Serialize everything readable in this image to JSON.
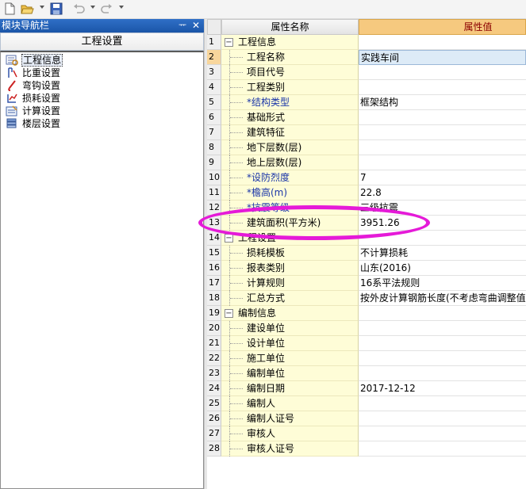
{
  "toolbar": {
    "buttons": [
      {
        "name": "new-file-icon"
      },
      {
        "name": "open-folder-icon"
      },
      {
        "name": "save-icon"
      },
      {
        "name": "undo-icon"
      },
      {
        "name": "redo-icon"
      }
    ]
  },
  "nav": {
    "title": "模块导航栏",
    "pin_glyph": "ᅲ",
    "close_glyph": "✕",
    "header": "工程设置",
    "items": [
      {
        "label": "工程信息",
        "icon": "project-info-icon",
        "selected": true
      },
      {
        "label": "比重设置",
        "icon": "density-icon",
        "selected": false
      },
      {
        "label": "弯钩设置",
        "icon": "hook-icon",
        "selected": false
      },
      {
        "label": "损耗设置",
        "icon": "loss-icon",
        "selected": false
      },
      {
        "label": "计算设置",
        "icon": "calc-settings-icon",
        "selected": false
      },
      {
        "label": "楼层设置",
        "icon": "floor-settings-icon",
        "selected": false
      }
    ]
  },
  "grid": {
    "col_name": "属性名称",
    "col_value": "属性值",
    "rows": [
      {
        "n": "1",
        "name": "工程信息",
        "value": "",
        "group": true
      },
      {
        "n": "2",
        "name": "工程名称",
        "value": "实践车间",
        "editing": true
      },
      {
        "n": "3",
        "name": "项目代号",
        "value": ""
      },
      {
        "n": "4",
        "name": "工程类别",
        "value": ""
      },
      {
        "n": "5",
        "name": "*结构类型",
        "value": "框架结构",
        "blue": true
      },
      {
        "n": "6",
        "name": "基础形式",
        "value": ""
      },
      {
        "n": "7",
        "name": "建筑特征",
        "value": ""
      },
      {
        "n": "8",
        "name": "地下层数(层)",
        "value": ""
      },
      {
        "n": "9",
        "name": "地上层数(层)",
        "value": ""
      },
      {
        "n": "10",
        "name": "*设防烈度",
        "value": "7",
        "blue": true
      },
      {
        "n": "11",
        "name": "*檐高(m)",
        "value": "22.8",
        "blue": true
      },
      {
        "n": "12",
        "name": "*抗震等级",
        "value": "三级抗震",
        "blue": true
      },
      {
        "n": "13",
        "name": "建筑面积(平方米)",
        "value": "3951.26"
      },
      {
        "n": "14",
        "name": "工程设置",
        "value": "",
        "group": true
      },
      {
        "n": "15",
        "name": "损耗模板",
        "value": "不计算损耗"
      },
      {
        "n": "16",
        "name": "报表类别",
        "value": "山东(2016)"
      },
      {
        "n": "17",
        "name": "计算规则",
        "value": "16系平法规则"
      },
      {
        "n": "18",
        "name": "汇总方式",
        "value": "按外皮计算钢筋长度(不考虑弯曲调整值)"
      },
      {
        "n": "19",
        "name": "编制信息",
        "value": "",
        "group": true
      },
      {
        "n": "20",
        "name": "建设单位",
        "value": ""
      },
      {
        "n": "21",
        "name": "设计单位",
        "value": ""
      },
      {
        "n": "22",
        "name": "施工单位",
        "value": ""
      },
      {
        "n": "23",
        "name": "编制单位",
        "value": ""
      },
      {
        "n": "24",
        "name": "编制日期",
        "value": "2017-12-12"
      },
      {
        "n": "25",
        "name": "编制人",
        "value": ""
      },
      {
        "n": "26",
        "name": "编制人证号",
        "value": ""
      },
      {
        "n": "27",
        "name": "审核人",
        "value": ""
      },
      {
        "n": "28",
        "name": "审核人证号",
        "value": ""
      }
    ]
  },
  "colors": {
    "annotation": "#e51ad8",
    "value_header": "#f6c97f",
    "name_column": "#fefdd7",
    "nav_title": "#1b56a8"
  }
}
